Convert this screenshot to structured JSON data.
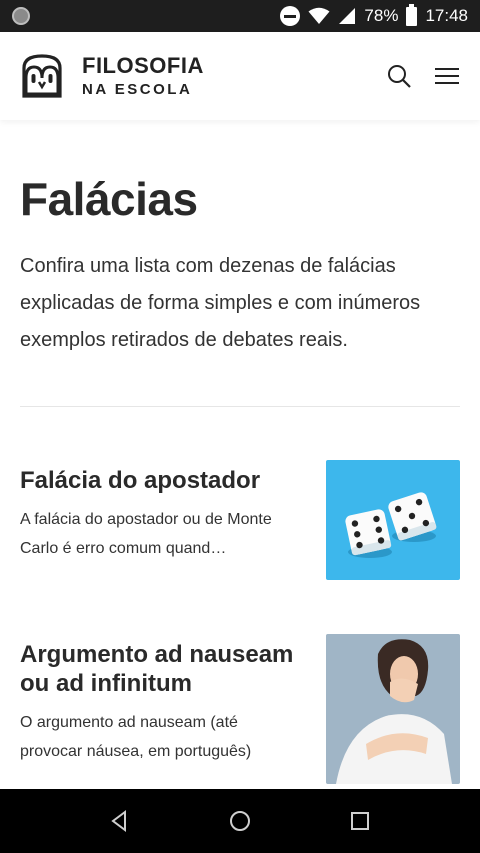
{
  "status_bar": {
    "battery": "78%",
    "time": "17:48",
    "icons": [
      "notification-dot-icon",
      "do-not-disturb-icon",
      "wifi-icon",
      "cell-signal-icon",
      "battery-charging-icon"
    ]
  },
  "header": {
    "brand_top": "FILOSOFIA",
    "brand_bottom": "NA ESCOLA",
    "icons": [
      "owl-logo-icon",
      "search-icon",
      "menu-icon"
    ]
  },
  "main": {
    "title": "Falácias",
    "intro": "Confira uma lista com dezenas de falácias explicadas de forma simples e com inúmeros exemplos retirados de debates reais."
  },
  "articles": [
    {
      "title": "Falácia do apostador",
      "excerpt": "A falácia do apostador ou de Monte Carlo é erro comum quand…",
      "thumb": "dice-image"
    },
    {
      "title": "Argumento ad nauseam ou ad infinitum",
      "excerpt": "O argumento ad nauseam (até provocar náusea, em português)",
      "thumb": "nauseous-woman-image"
    }
  ],
  "nav_bar": {
    "icons": [
      "back-icon",
      "home-icon",
      "recents-icon"
    ]
  },
  "colors": {
    "status_bar": "#1e1e1e",
    "dice_background": "#3db7ec",
    "text": "#2a2a2a"
  }
}
